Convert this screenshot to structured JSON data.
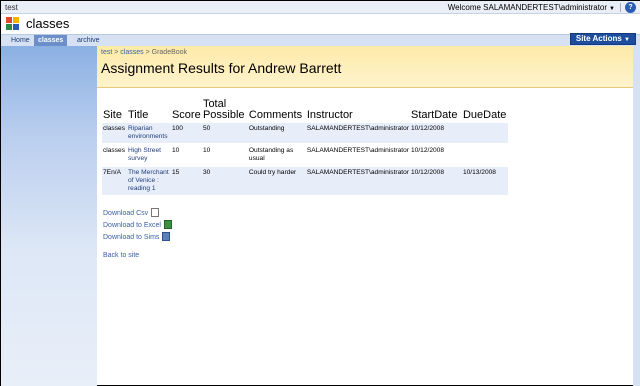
{
  "topbar": {
    "site_name": "test",
    "welcome": "Welcome SALAMANDERTEST\\administrator",
    "welcome_caret": "▼",
    "help": "?"
  },
  "site": {
    "title": "classes"
  },
  "nav": {
    "tabs": [
      "Home",
      "classes",
      "archive"
    ],
    "selected": "classes"
  },
  "site_actions": {
    "label": "Site Actions",
    "caret": "▼"
  },
  "breadcrumb": {
    "items": [
      "test",
      "classes",
      "GradeBook"
    ],
    "separator": ">"
  },
  "page": {
    "title": "Assignment Results for Andrew Barrett"
  },
  "table": {
    "headers": [
      "Site",
      "Title",
      "Score",
      "Total Possible",
      "Comments",
      "Instructor",
      "StartDate",
      "DueDate"
    ],
    "rows": [
      [
        "classes",
        "Riparian environments",
        "100",
        "50",
        "Outstanding",
        "SALAMANDERTEST\\administrator",
        "10/12/2008",
        ""
      ],
      [
        "classes",
        "High Street survey",
        "10",
        "10",
        "Outstanding as usual",
        "SALAMANDERTEST\\administrator",
        "10/12/2008",
        ""
      ],
      [
        "7En/A",
        "The Merchant of Venice : reading 1",
        "15",
        "30",
        "Could try harder",
        "SALAMANDERTEST\\administrator",
        "10/12/2008",
        "10/13/2008"
      ]
    ]
  },
  "downloads": [
    {
      "label": "Download Csv",
      "icon": "csv-file-icon"
    },
    {
      "label": "Download to Excel",
      "icon": "excel-icon"
    },
    {
      "label": "Download to Sims",
      "icon": "sims-icon"
    }
  ],
  "back_link": "Back to site",
  "colors": {
    "accent": "#1f4d9e",
    "header_bg": "#fff3cd",
    "row_alt": "#e7eefa"
  }
}
